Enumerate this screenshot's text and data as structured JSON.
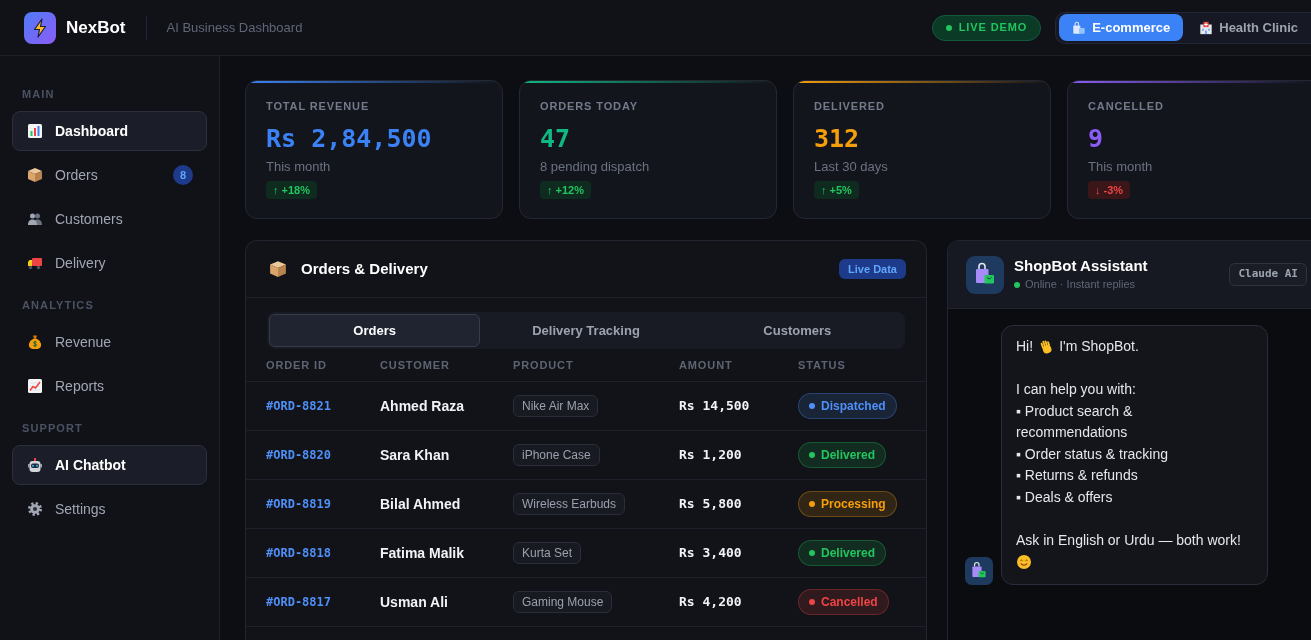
{
  "header": {
    "brand": "NexBot",
    "subtitle": "AI Business Dashboard",
    "live_badge": "LIVE DEMO",
    "modes": [
      {
        "label": "E-commerce",
        "selected": true
      },
      {
        "label": "Health Clinic",
        "selected": false
      }
    ]
  },
  "sidebar": {
    "sections": [
      {
        "label": "MAIN",
        "items": [
          {
            "label": "Dashboard",
            "selected": true
          },
          {
            "label": "Orders",
            "selected": false,
            "badge": "8"
          },
          {
            "label": "Customers",
            "selected": false
          },
          {
            "label": "Delivery",
            "selected": false
          }
        ]
      },
      {
        "label": "ANALYTICS",
        "items": [
          {
            "label": "Revenue",
            "selected": false
          },
          {
            "label": "Reports",
            "selected": false
          }
        ]
      },
      {
        "label": "SUPPORT",
        "items": [
          {
            "label": "AI Chatbot",
            "selected": true
          },
          {
            "label": "Settings",
            "selected": false
          }
        ]
      }
    ]
  },
  "stats": [
    {
      "label": "TOTAL REVENUE",
      "value": "Rs 2,84,500",
      "note": "This month",
      "change": "↑ +18%",
      "negative": false,
      "color": "#3b82f6"
    },
    {
      "label": "ORDERS TODAY",
      "value": "47",
      "note": "8 pending dispatch",
      "change": "↑ +12%",
      "negative": false,
      "color": "#10b981"
    },
    {
      "label": "DELIVERED",
      "value": "312",
      "note": "Last 30 days",
      "change": "↑ +5%",
      "negative": false,
      "color": "#f59e0b"
    },
    {
      "label": "CANCELLED",
      "value": "9",
      "note": "This month",
      "change": "↓ -3%",
      "negative": true,
      "color": "#8b5cf6"
    }
  ],
  "orders_panel": {
    "title": "Orders & Delivery",
    "badge": "Live Data",
    "tabs": [
      {
        "label": "Orders",
        "selected": true
      },
      {
        "label": "Delivery Tracking",
        "selected": false
      },
      {
        "label": "Customers",
        "selected": false
      }
    ],
    "table": {
      "columns": [
        "ORDER ID",
        "CUSTOMER",
        "PRODUCT",
        "AMOUNT",
        "STATUS"
      ],
      "rows": [
        {
          "order_id": "#ORD-8821",
          "customer": "Ahmed Raza",
          "product": "Nike Air Max",
          "amount": "Rs 14,500",
          "status": "Dispatched",
          "color": "#4f8ff7"
        },
        {
          "order_id": "#ORD-8820",
          "customer": "Sara Khan",
          "product": "iPhone Case",
          "amount": "Rs 1,200",
          "status": "Delivered",
          "color": "#22c55e"
        },
        {
          "order_id": "#ORD-8819",
          "customer": "Bilal Ahmed",
          "product": "Wireless Earbuds",
          "amount": "Rs 5,800",
          "status": "Processing",
          "color": "#f59e0b"
        },
        {
          "order_id": "#ORD-8818",
          "customer": "Fatima Malik",
          "product": "Kurta Set",
          "amount": "Rs 3,400",
          "status": "Delivered",
          "color": "#22c55e"
        },
        {
          "order_id": "#ORD-8817",
          "customer": "Usman Ali",
          "product": "Gaming Mouse",
          "amount": "Rs 4,200",
          "status": "Cancelled",
          "color": "#ef4444"
        }
      ]
    }
  },
  "chat": {
    "title": "ShopBot Assistant",
    "status": "Online · Instant replies",
    "model_badge": "Claude AI",
    "message": {
      "greeting": {
        "before": "Hi!",
        "after": "I'm ShopBot."
      },
      "intro": "I can help you with:",
      "bullets": [
        "▪ Product search & recommendations",
        "▪ Order status & tracking",
        "▪ Returns & refunds",
        "▪ Deals & offers"
      ],
      "closing": "Ask in English or Urdu — both work!"
    }
  }
}
